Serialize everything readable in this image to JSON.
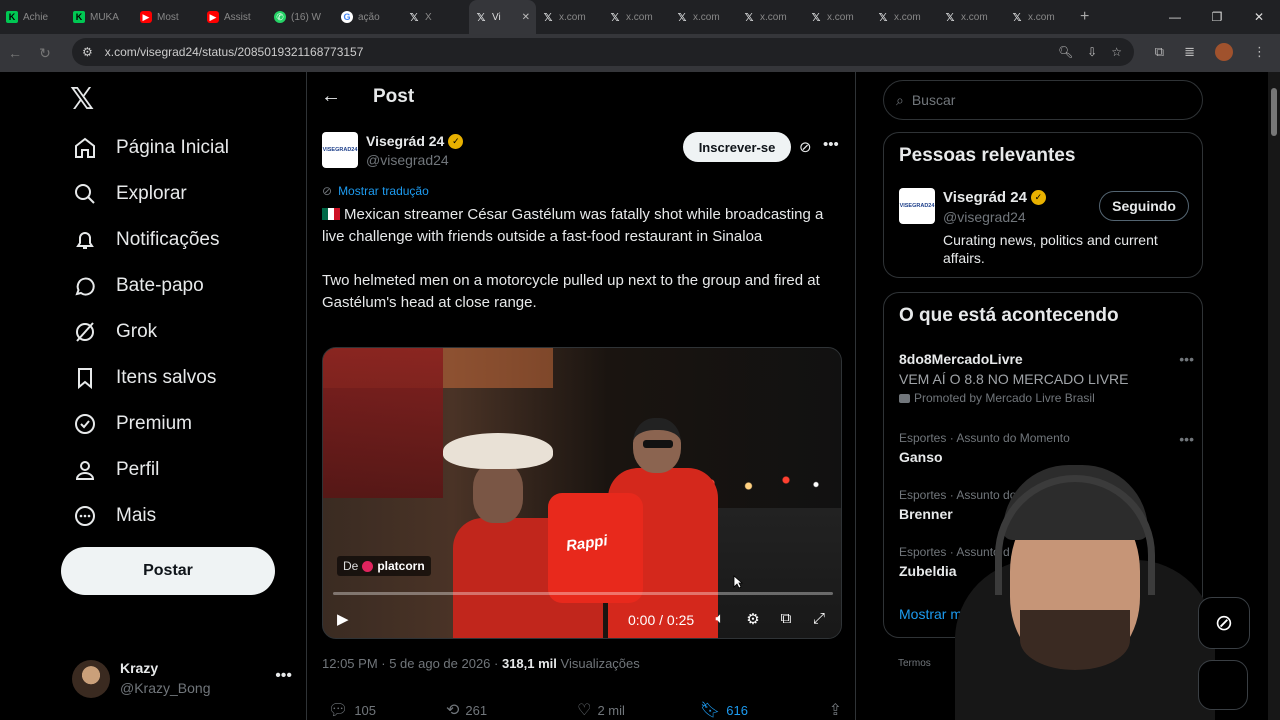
{
  "browser": {
    "tabs": [
      {
        "title": "Achie",
        "icon": "k-icon"
      },
      {
        "title": "MUKA",
        "icon": "k-icon"
      },
      {
        "title": "Most",
        "icon": "youtube-icon"
      },
      {
        "title": "Assist",
        "icon": "youtube-icon"
      },
      {
        "title": "(16) W",
        "icon": "whatsapp-icon"
      },
      {
        "title": "ação",
        "icon": "google-icon"
      },
      {
        "title": "X",
        "icon": "x-icon"
      },
      {
        "title": "Vi",
        "icon": "x-icon"
      },
      {
        "title": "x.com",
        "icon": "x-icon"
      },
      {
        "title": "x.com",
        "icon": "x-icon"
      },
      {
        "title": "x.com",
        "icon": "x-icon"
      },
      {
        "title": "x.com",
        "icon": "x-icon"
      },
      {
        "title": "x.com",
        "icon": "x-icon"
      },
      {
        "title": "x.com",
        "icon": "x-icon"
      },
      {
        "title": "x.com",
        "icon": "x-icon"
      },
      {
        "title": "x.com",
        "icon": "x-icon"
      }
    ],
    "url": "x.com/visegrad24/status/2085019321168773157"
  },
  "sidebar": {
    "logo": "𝕏",
    "items": [
      {
        "label": "Página Inicial",
        "icon": "home-icon"
      },
      {
        "label": "Explorar",
        "icon": "search-icon"
      },
      {
        "label": "Notificações",
        "icon": "bell-icon"
      },
      {
        "label": "Bate-papo",
        "icon": "chat-icon"
      },
      {
        "label": "Grok",
        "icon": "grok-icon"
      },
      {
        "label": "Itens salvos",
        "icon": "bookmark-icon"
      },
      {
        "label": "Premium",
        "icon": "premium-icon"
      },
      {
        "label": "Perfil",
        "icon": "person-icon"
      },
      {
        "label": "Mais",
        "icon": "more-circle-icon"
      }
    ],
    "post_button": "Postar",
    "account": {
      "name": "Krazy",
      "handle": "@Krazy_Bong"
    }
  },
  "main": {
    "header_title": "Post",
    "author": {
      "name": "Visegrád 24",
      "handle": "@visegrad24",
      "avatar_text": "VISEGRAD24"
    },
    "subscribe_label": "Inscrever-se",
    "translate_label": "Mostrar tradução",
    "text_p1": "Mexican streamer César Gastélum was fatally shot while broadcasting a live challenge with friends outside a fast-food restaurant in Sinaloa",
    "text_p2": "Two helmeted men on a motorcycle pulled up next to the group and fired at Gastélum's head at close range.",
    "video": {
      "source_prefix": "De",
      "source_name": "platcorn",
      "bag_text": "Rappi",
      "time": "0:00 / 0:25",
      "progress": 0
    },
    "meta": {
      "time": "12:05 PM · 5 de ago de 2026 · ",
      "views": "318,1 mil",
      "views_label": " Visualizações"
    },
    "actions": {
      "replies": "105",
      "reposts": "261",
      "likes": "2 mil",
      "bookmarks": "616"
    }
  },
  "right": {
    "search_placeholder": "Buscar",
    "relevant": {
      "title": "Pessoas relevantes",
      "name": "Visegrád 24",
      "handle": "@visegrad24",
      "bio": "Curating news, politics and current affairs.",
      "follow_label": "Seguindo",
      "avatar_text": "VISEGRAD24"
    },
    "trends": {
      "title": "O que está acontecendo",
      "items": [
        {
          "category": "",
          "title": "8do8MercadoLivre",
          "desc": "VEM AÍ O 8.8 NO MERCADO LIVRE",
          "promo": "Promoted by Mercado Livre Brasil"
        },
        {
          "category": "Esportes · Assunto do Momento",
          "title": "Ganso"
        },
        {
          "category": "Esportes · Assunto do Mom",
          "title": "Brenner"
        },
        {
          "category": "Esportes · Assunto d",
          "title": "Zubeldia"
        }
      ],
      "show_more": "Mostrar mais"
    },
    "terms": "Termos"
  }
}
